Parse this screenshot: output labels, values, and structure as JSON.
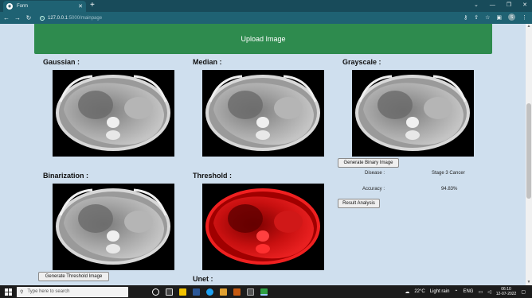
{
  "browser": {
    "tab_title": "Form",
    "url_host": "127.0.0.1",
    "url_rest": ":5000/mainpage",
    "profile_initial": "S"
  },
  "page": {
    "upload_label": "Upload Image",
    "sections": {
      "gaussian": "Gaussian :",
      "median": "Median :",
      "grayscale": "Grayscale :",
      "binarization": "Binarization :",
      "threshold": "Threshold :",
      "unet": "Unet :"
    },
    "buttons": {
      "generate_binary": "Generate Binary Image",
      "generate_threshold": "Generate Threshold Image",
      "result_analysis": "Result Analysis"
    },
    "results": {
      "disease_label": "Disease :",
      "disease_value": "Stage 3 Cancer",
      "accuracy_label": "Accuracy :",
      "accuracy_value": "94.83%"
    }
  },
  "taskbar": {
    "search_placeholder": "Type here to search",
    "weather_temp": "22°C",
    "weather_desc": "Light rain",
    "language": "ENG",
    "time": "06:10",
    "date": "12-07-2022"
  },
  "colors": {
    "upload_green": "#2e8b4e",
    "page_bg": "#cfdfee",
    "browser_chrome": "#1f6273",
    "threshold_red": "#e01010"
  }
}
